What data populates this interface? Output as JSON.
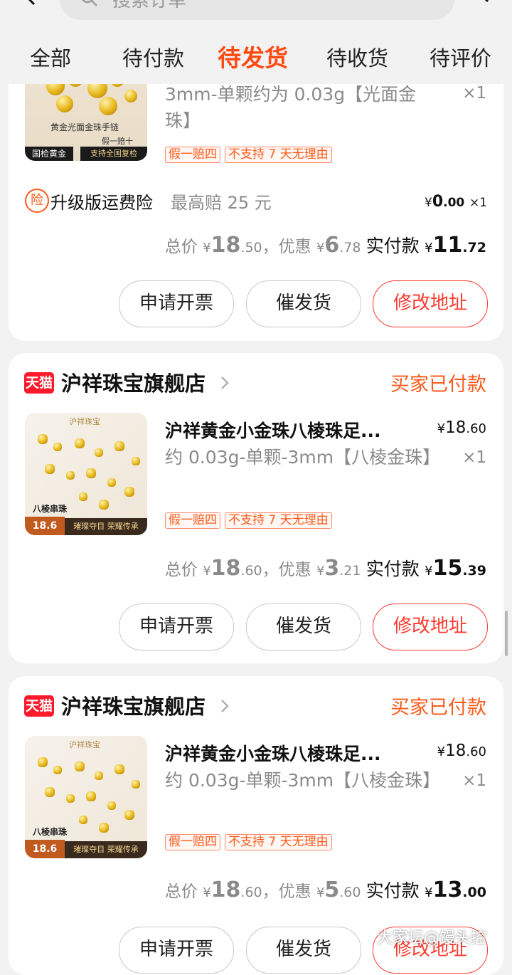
{
  "search": {
    "placeholder": "搜索订单"
  },
  "tabs": [
    {
      "label": "全部"
    },
    {
      "label": "待付款"
    },
    {
      "label": "待发货",
      "active": true
    },
    {
      "label": "待收货"
    },
    {
      "label": "待评价"
    }
  ],
  "colors": {
    "accent": "#ff4a12",
    "status": "#ff5a1a",
    "danger": "#ff3b30",
    "tmall": "#ff1a2b"
  },
  "order1": {
    "spec": "3mm-单颗约为 0.03g【光面金珠】",
    "qty": "×1",
    "image": {
      "caption_line1": "黄金光面金珠手链",
      "caption_false": "假一赔十",
      "caption_cert": "国检黄金",
      "caption_recheck": "支持全国复检"
    },
    "tags": [
      "假一赔四",
      "不支持 7 天无理由"
    ],
    "insurance": {
      "icon": "险",
      "name": "升级版运费险",
      "note": "最高赔 25 元",
      "price_sym": "¥",
      "price_int": "0",
      "price_dec": ".00",
      "qty": "×1"
    },
    "summary": {
      "total_label": "总价",
      "total_int": "18",
      "total_dec": ".50",
      "discount_label": "，优惠",
      "discount_int": "6",
      "discount_dec": ".78",
      "pay_label": "实付款",
      "pay_int": "11",
      "pay_dec": ".72",
      "currency": "¥"
    },
    "buttons": {
      "invoice": "申请开票",
      "urge": "催发货",
      "address": "修改地址"
    }
  },
  "order2": {
    "shop_badge": "天猫",
    "shop_name": "沪祥珠宝旗舰店",
    "status": "买家已付款",
    "title": "沪祥黄金小金珠八棱珠足...",
    "price_sym": "¥",
    "price_int": "18",
    "price_dec": ".60",
    "spec": "约 0.03g-单颗-3mm【八棱金珠】",
    "qty": "×1",
    "image": {
      "brand": "沪祥珠宝",
      "label": "八棱串珠",
      "price": "18.6",
      "slogan": "璀璨夺目 荣耀传承"
    },
    "tags": [
      "假一赔四",
      "不支持 7 天无理由"
    ],
    "summary": {
      "total_label": "总价",
      "total_int": "18",
      "total_dec": ".60",
      "discount_label": "，优惠",
      "discount_int": "3",
      "discount_dec": ".21",
      "pay_label": "实付款",
      "pay_int": "15",
      "pay_dec": ".39",
      "currency": "¥"
    },
    "buttons": {
      "invoice": "申请开票",
      "urge": "催发货",
      "address": "修改地址"
    }
  },
  "order3": {
    "shop_badge": "天猫",
    "shop_name": "沪祥珠宝旗舰店",
    "status": "买家已付款",
    "title": "沪祥黄金小金珠八棱珠足...",
    "price_sym": "¥",
    "price_int": "18",
    "price_dec": ".60",
    "spec": "约 0.03g-单颗-3mm【八棱金珠】",
    "qty": "×1",
    "image": {
      "brand": "沪祥珠宝",
      "label": "八棱串珠",
      "price": "18.6",
      "slogan": "璀璨夺目 荣耀传承"
    },
    "tags": [
      "假一赔四",
      "不支持 7 天无理由"
    ],
    "summary": {
      "total_label": "总价",
      "total_int": "18",
      "total_dec": ".60",
      "discount_label": "，优惠",
      "discount_int": "5",
      "discount_dec": ".60",
      "pay_label": "实付款",
      "pay_int": "13",
      "pay_dec": ".00",
      "currency": "¥"
    },
    "buttons": {
      "invoice": "申请开票",
      "urge": "催发货",
      "address": "修改地址"
    }
  },
  "watermark": "大家坛@馒头控"
}
